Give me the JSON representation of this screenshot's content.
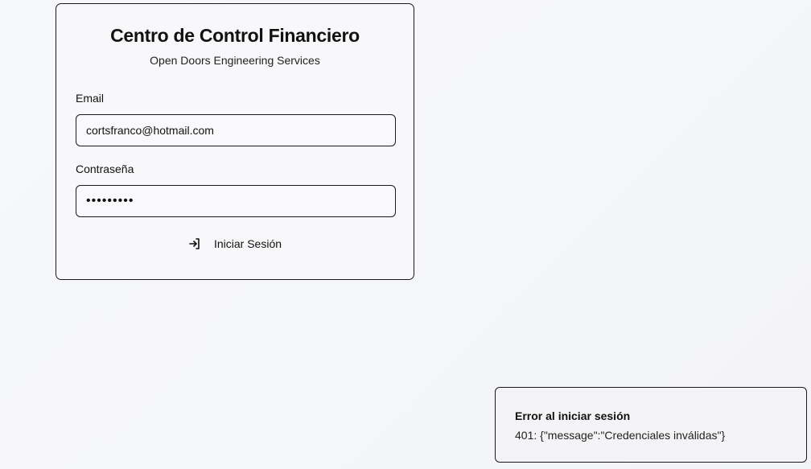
{
  "login": {
    "title": "Centro de Control Financiero",
    "subtitle": "Open Doors Engineering Services",
    "email_label": "Email",
    "email_value": "cortsfranco@hotmail.com",
    "password_label": "Contraseña",
    "password_value": "•••••••••",
    "submit_label": "Iniciar Sesión",
    "submit_icon": "log-in-icon"
  },
  "toast": {
    "title": "Error al iniciar sesión",
    "message": "401: {\"message\":\"Credenciales inválidas\"}"
  }
}
